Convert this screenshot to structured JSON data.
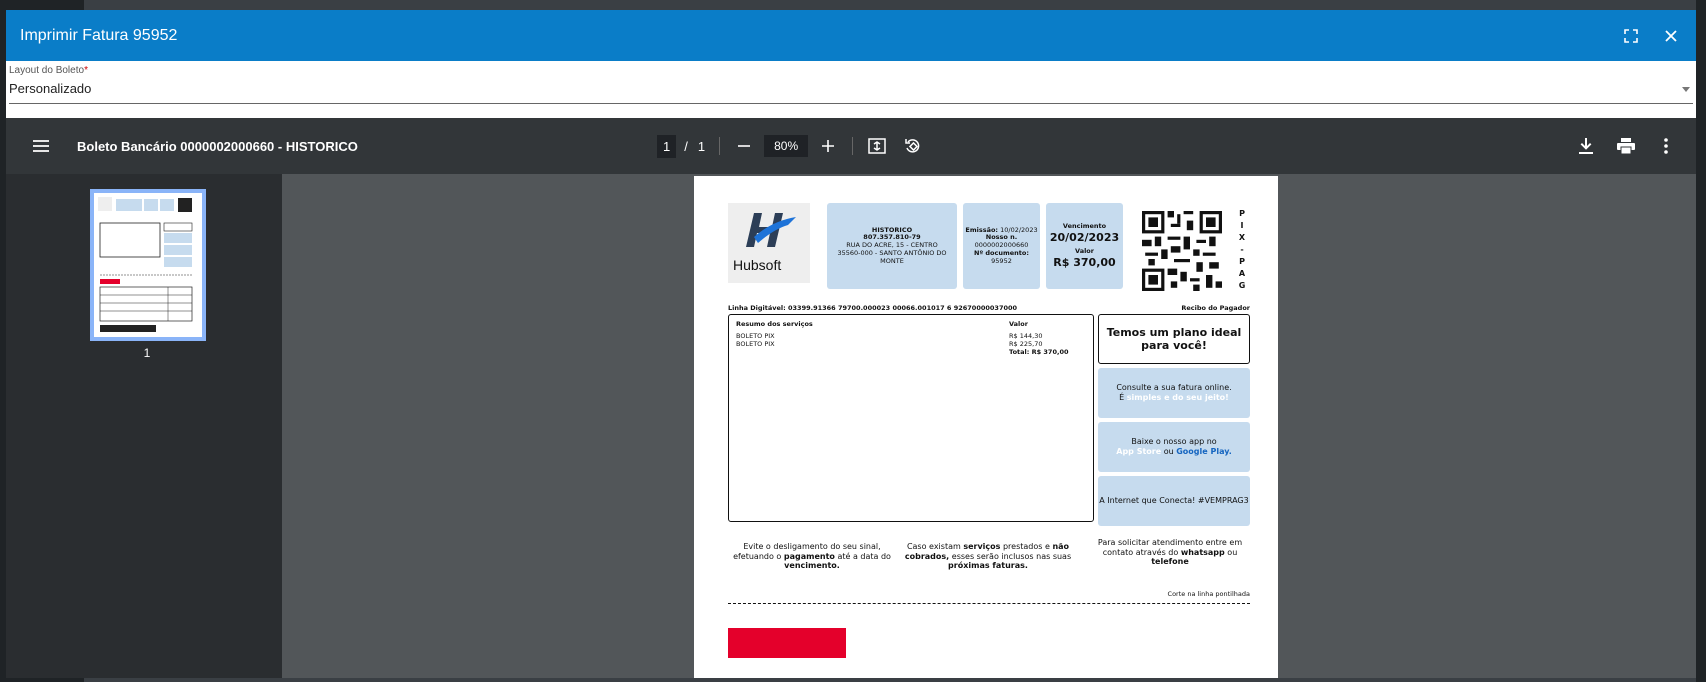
{
  "dialog": {
    "title": "Imprimir Fatura 95952"
  },
  "layout_field": {
    "label": "Layout do Boleto",
    "required_mark": "*",
    "value": "Personalizado"
  },
  "pdf_toolbar": {
    "doc_title": "Boleto Bancário 0000002000660 - HISTORICO",
    "page_current": "1",
    "page_separator": "/",
    "page_total": "1",
    "zoom": "80%"
  },
  "sidebar": {
    "thumb_label": "1"
  },
  "boleto": {
    "logo_text": "Hubsoft",
    "payer": {
      "name": "HISTORICO",
      "doc": "807.357.810-79",
      "address1": "RUA DO ACRE, 15 - CENTRO",
      "address2": "35560-000 - SANTO ANTÔNIO DO MONTE"
    },
    "emissao_label": "Emissão:",
    "emissao_value": "10/02/2023",
    "nosso_label": "Nosso n.",
    "nosso_value": "0000002000660",
    "ndoc_label": "Nº documento:",
    "ndoc_value": "95952",
    "vencimento_label": "Vencimento",
    "vencimento_value": "20/02/2023",
    "valor_label": "Valor",
    "valor_value": "R$ 370,00",
    "pix_label": "PIX-PAG",
    "linha_digitavel": "Linha Digitável: 03399.91366 79700.000023 00066.001017 6 92670000037000",
    "recibo": "Recibo do Pagador",
    "resumo_title": "Resumo dos serviços",
    "resumo_valor_title": "Valor",
    "services": [
      {
        "name": "BOLETO PIX",
        "value": "R$ 144,30"
      },
      {
        "name": "BOLETO PIX",
        "value": "R$ 225,70"
      }
    ],
    "total": "Total: R$ 370,00",
    "card_plano": "Temos um plano ideal para você!",
    "card_consulte_1": "Consulte a sua fatura online.",
    "card_consulte_2": "É",
    "card_consulte_link": "simples e do seu jeito!",
    "card_app_1": "Baixe o nosso app no",
    "card_app_link1": "App Store",
    "card_app_or": "ou",
    "card_app_link2": "Google Play.",
    "card_internet": "A Internet que Conecta! #VEMPRAG3",
    "info1_pre": "Evite o desligamento do seu sinal, efetuando o",
    "info1_bold1": "pagamento",
    "info1_mid": "até a data do",
    "info1_bold2": "vencimento.",
    "info2_pre": "Caso existam",
    "info2_bold1": "serviços",
    "info2_mid": "prestados e",
    "info2_bold2": "não cobrados,",
    "info2_mid2": "esses serão inclusos nas suas",
    "info2_bold3": "próximas faturas.",
    "info3_pre": "Para solicitar atendimento entre em contato através do",
    "info3_bold1": "whatsapp",
    "info3_mid": "ou",
    "info3_bold2": "telefone",
    "corte": "Corte na linha pontilhada"
  },
  "colors": {
    "titlebar": "#0a7dc8",
    "pdf_toolbar": "#323639",
    "viewer_bg": "#525659",
    "card_blue": "#c6dbee",
    "brand_red": "#e4002b"
  }
}
